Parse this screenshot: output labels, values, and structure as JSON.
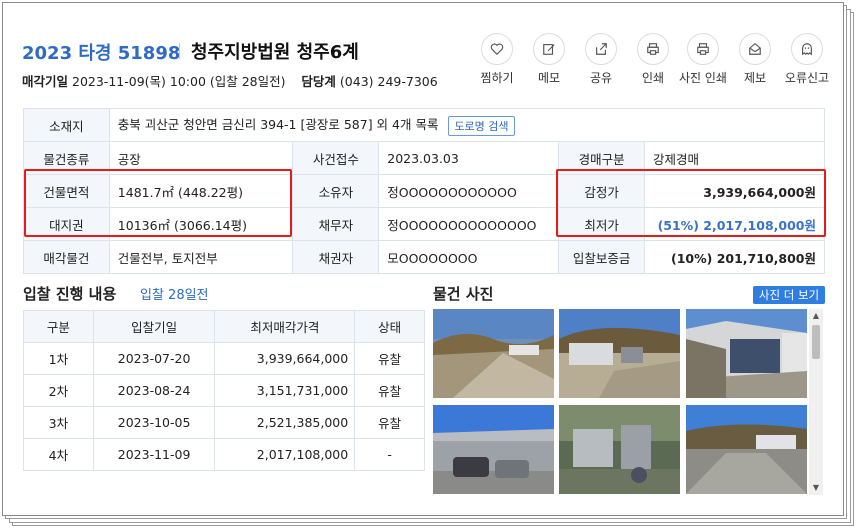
{
  "header": {
    "case_no": "2023 타경 51898",
    "court": "청주지방법원 청주6계",
    "sale_date_label": "매각기일",
    "sale_date_value": "2023-11-09(목) 10:00 (입찰 28일전)",
    "manager_label": "담당계",
    "manager_value": "(043) 249-7306"
  },
  "actions": [
    {
      "label": "찜하기",
      "icon": "heart-icon"
    },
    {
      "label": "메모",
      "icon": "memo-icon"
    },
    {
      "label": "공유",
      "icon": "share-icon"
    },
    {
      "label": "인쇄",
      "icon": "print-icon"
    },
    {
      "label": "사진 인쇄",
      "icon": "photo-print-icon"
    },
    {
      "label": "제보",
      "icon": "report-mail-icon"
    },
    {
      "label": "오류신고",
      "icon": "ghost-icon"
    }
  ],
  "info": {
    "location_label": "소재지",
    "location_value": "충북 괴산군 청안면 금신리 394-1 [광장로 587] 외 4개 목록",
    "road_search": "도로명 검색",
    "type_label": "물건종류",
    "type_value": "공장",
    "case_received_label": "사건접수",
    "case_received_value": "2023.03.03",
    "auction_type_label": "경매구분",
    "auction_type_value": "강제경매",
    "building_area_label": "건물면적",
    "building_area_value": "1481.7㎡ (448.22평)",
    "owner_label": "소유자",
    "owner_value": "정OOOOOOOOOOOO",
    "appraisal_label": "감정가",
    "appraisal_value": "3,939,664,000원",
    "land_label": "대지권",
    "land_value": "10136㎡ (3066.14평)",
    "debtor_label": "채무자",
    "debtor_value": "정OOOOOOOOOOOOOO",
    "min_price_label": "최저가",
    "min_price_value": "(51%) 2,017,108,000원",
    "sale_item_label": "매각물건",
    "sale_item_value": "건물전부, 토지전부",
    "creditor_label": "채권자",
    "creditor_value": "모OOOOOOOO",
    "deposit_label": "입찰보증금",
    "deposit_value": "(10%) 201,710,800원"
  },
  "bid_section": {
    "title": "입찰 진행 내용",
    "sub": "입찰 28일전",
    "headers": [
      "구분",
      "입찰기일",
      "최저매각가격",
      "상태"
    ],
    "rows": [
      [
        "1차",
        "2023-07-20",
        "3,939,664,000",
        "유찰"
      ],
      [
        "2차",
        "2023-08-24",
        "3,151,731,000",
        "유찰"
      ],
      [
        "3차",
        "2023-10-05",
        "2,521,385,000",
        "유찰"
      ],
      [
        "4차",
        "2023-11-09",
        "2,017,108,000",
        "-"
      ]
    ]
  },
  "photo_section": {
    "title": "물건 사진",
    "more_button": "사진 더 보기"
  },
  "colors": {
    "accent_blue": "#2d6bc7",
    "highlight_red": "#e31c1c",
    "header_cell_bg": "#f3f6fa"
  }
}
